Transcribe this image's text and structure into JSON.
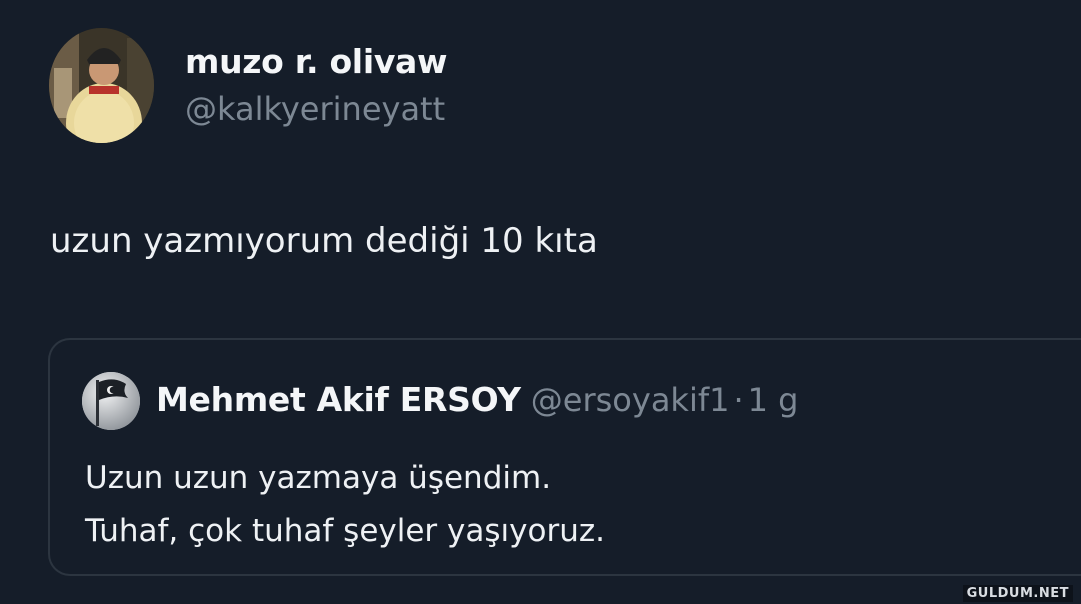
{
  "author": {
    "name": "muzo r. olivaw",
    "handle": "@kalkyerineyatt",
    "avatar_icon": "person-photo-avatar"
  },
  "tweet": {
    "text": "uzun yazmıyorum dediği 10 kıta"
  },
  "quoted_tweet": {
    "name": "Mehmet Akif ERSOY",
    "handle": "@ersoyakif1",
    "separator": "·",
    "time": "1 g",
    "avatar_icon": "flag-avatar",
    "lines": [
      "Uzun uzun yazmaya üşendim.",
      "Tuhaf, çok tuhaf şeyler yaşıyoruz."
    ]
  },
  "watermark": "GULDUM.NET",
  "colors": {
    "background": "#151d29",
    "primary_text": "#eef1f4",
    "secondary_text": "#7d8894",
    "border": "#2c3540"
  }
}
